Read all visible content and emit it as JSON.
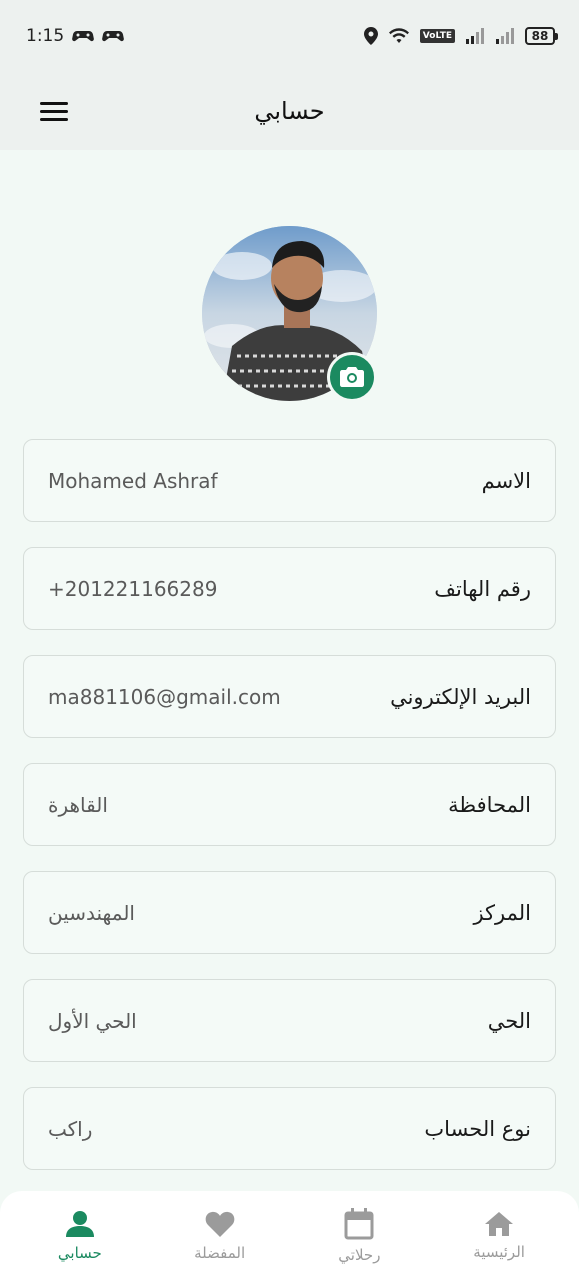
{
  "status_bar": {
    "time": "1:15",
    "battery": "88",
    "volte": "VoLTE"
  },
  "app_bar": {
    "title": "حسابي"
  },
  "colors": {
    "accent": "#1b8a60",
    "background": "#f2f9f5",
    "appbar": "#edf1ef",
    "inactive": "#9b9b9b"
  },
  "profile": {
    "avatar_icon": "profile-photo",
    "camera_icon": "camera-icon"
  },
  "fields": [
    {
      "label": "الاسم",
      "value": "Mohamed Ashraf"
    },
    {
      "label": "رقم الهاتف",
      "value": "+201221166289"
    },
    {
      "label": "البريد الإلكتروني",
      "value": "ma881106@gmail.com"
    },
    {
      "label": "المحافظة",
      "value": "القاهرة"
    },
    {
      "label": "المركز",
      "value": "المهندسين"
    },
    {
      "label": "الحي",
      "value": "الحي الأول"
    },
    {
      "label": "نوع الحساب",
      "value": "راكب"
    }
  ],
  "bottom_nav": [
    {
      "label": "الرئيسية",
      "icon": "home-icon",
      "active": false
    },
    {
      "label": "رحلاتي",
      "icon": "calendar-icon",
      "active": false
    },
    {
      "label": "المفضلة",
      "icon": "heart-icon",
      "active": false
    },
    {
      "label": "حسابي",
      "icon": "person-icon",
      "active": true
    }
  ]
}
